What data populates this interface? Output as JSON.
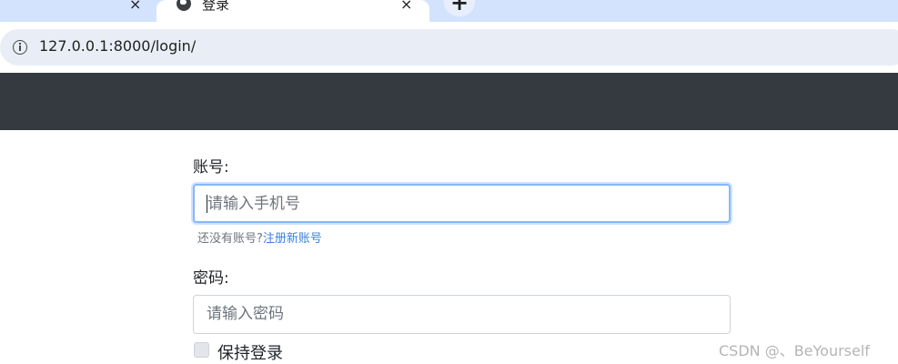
{
  "browser": {
    "prev_tab_close": "×",
    "active_tab_title": "登录",
    "active_tab_close": "×",
    "new_tab": "+",
    "url": "127.0.0.1:8000/login/"
  },
  "form": {
    "account_label": "账号:",
    "phone_placeholder": "请输入手机号",
    "hint_text": "还没有账号?",
    "register_link": "注册新账号",
    "password_label": "密码:",
    "password_placeholder": "请输入密码",
    "remember_label": "保持登录"
  },
  "watermark": "CSDN @、BeYourself",
  "colors": {
    "navbar": "#343a40",
    "link": "#3d7fe0",
    "focus_border": "#86b7fe"
  }
}
